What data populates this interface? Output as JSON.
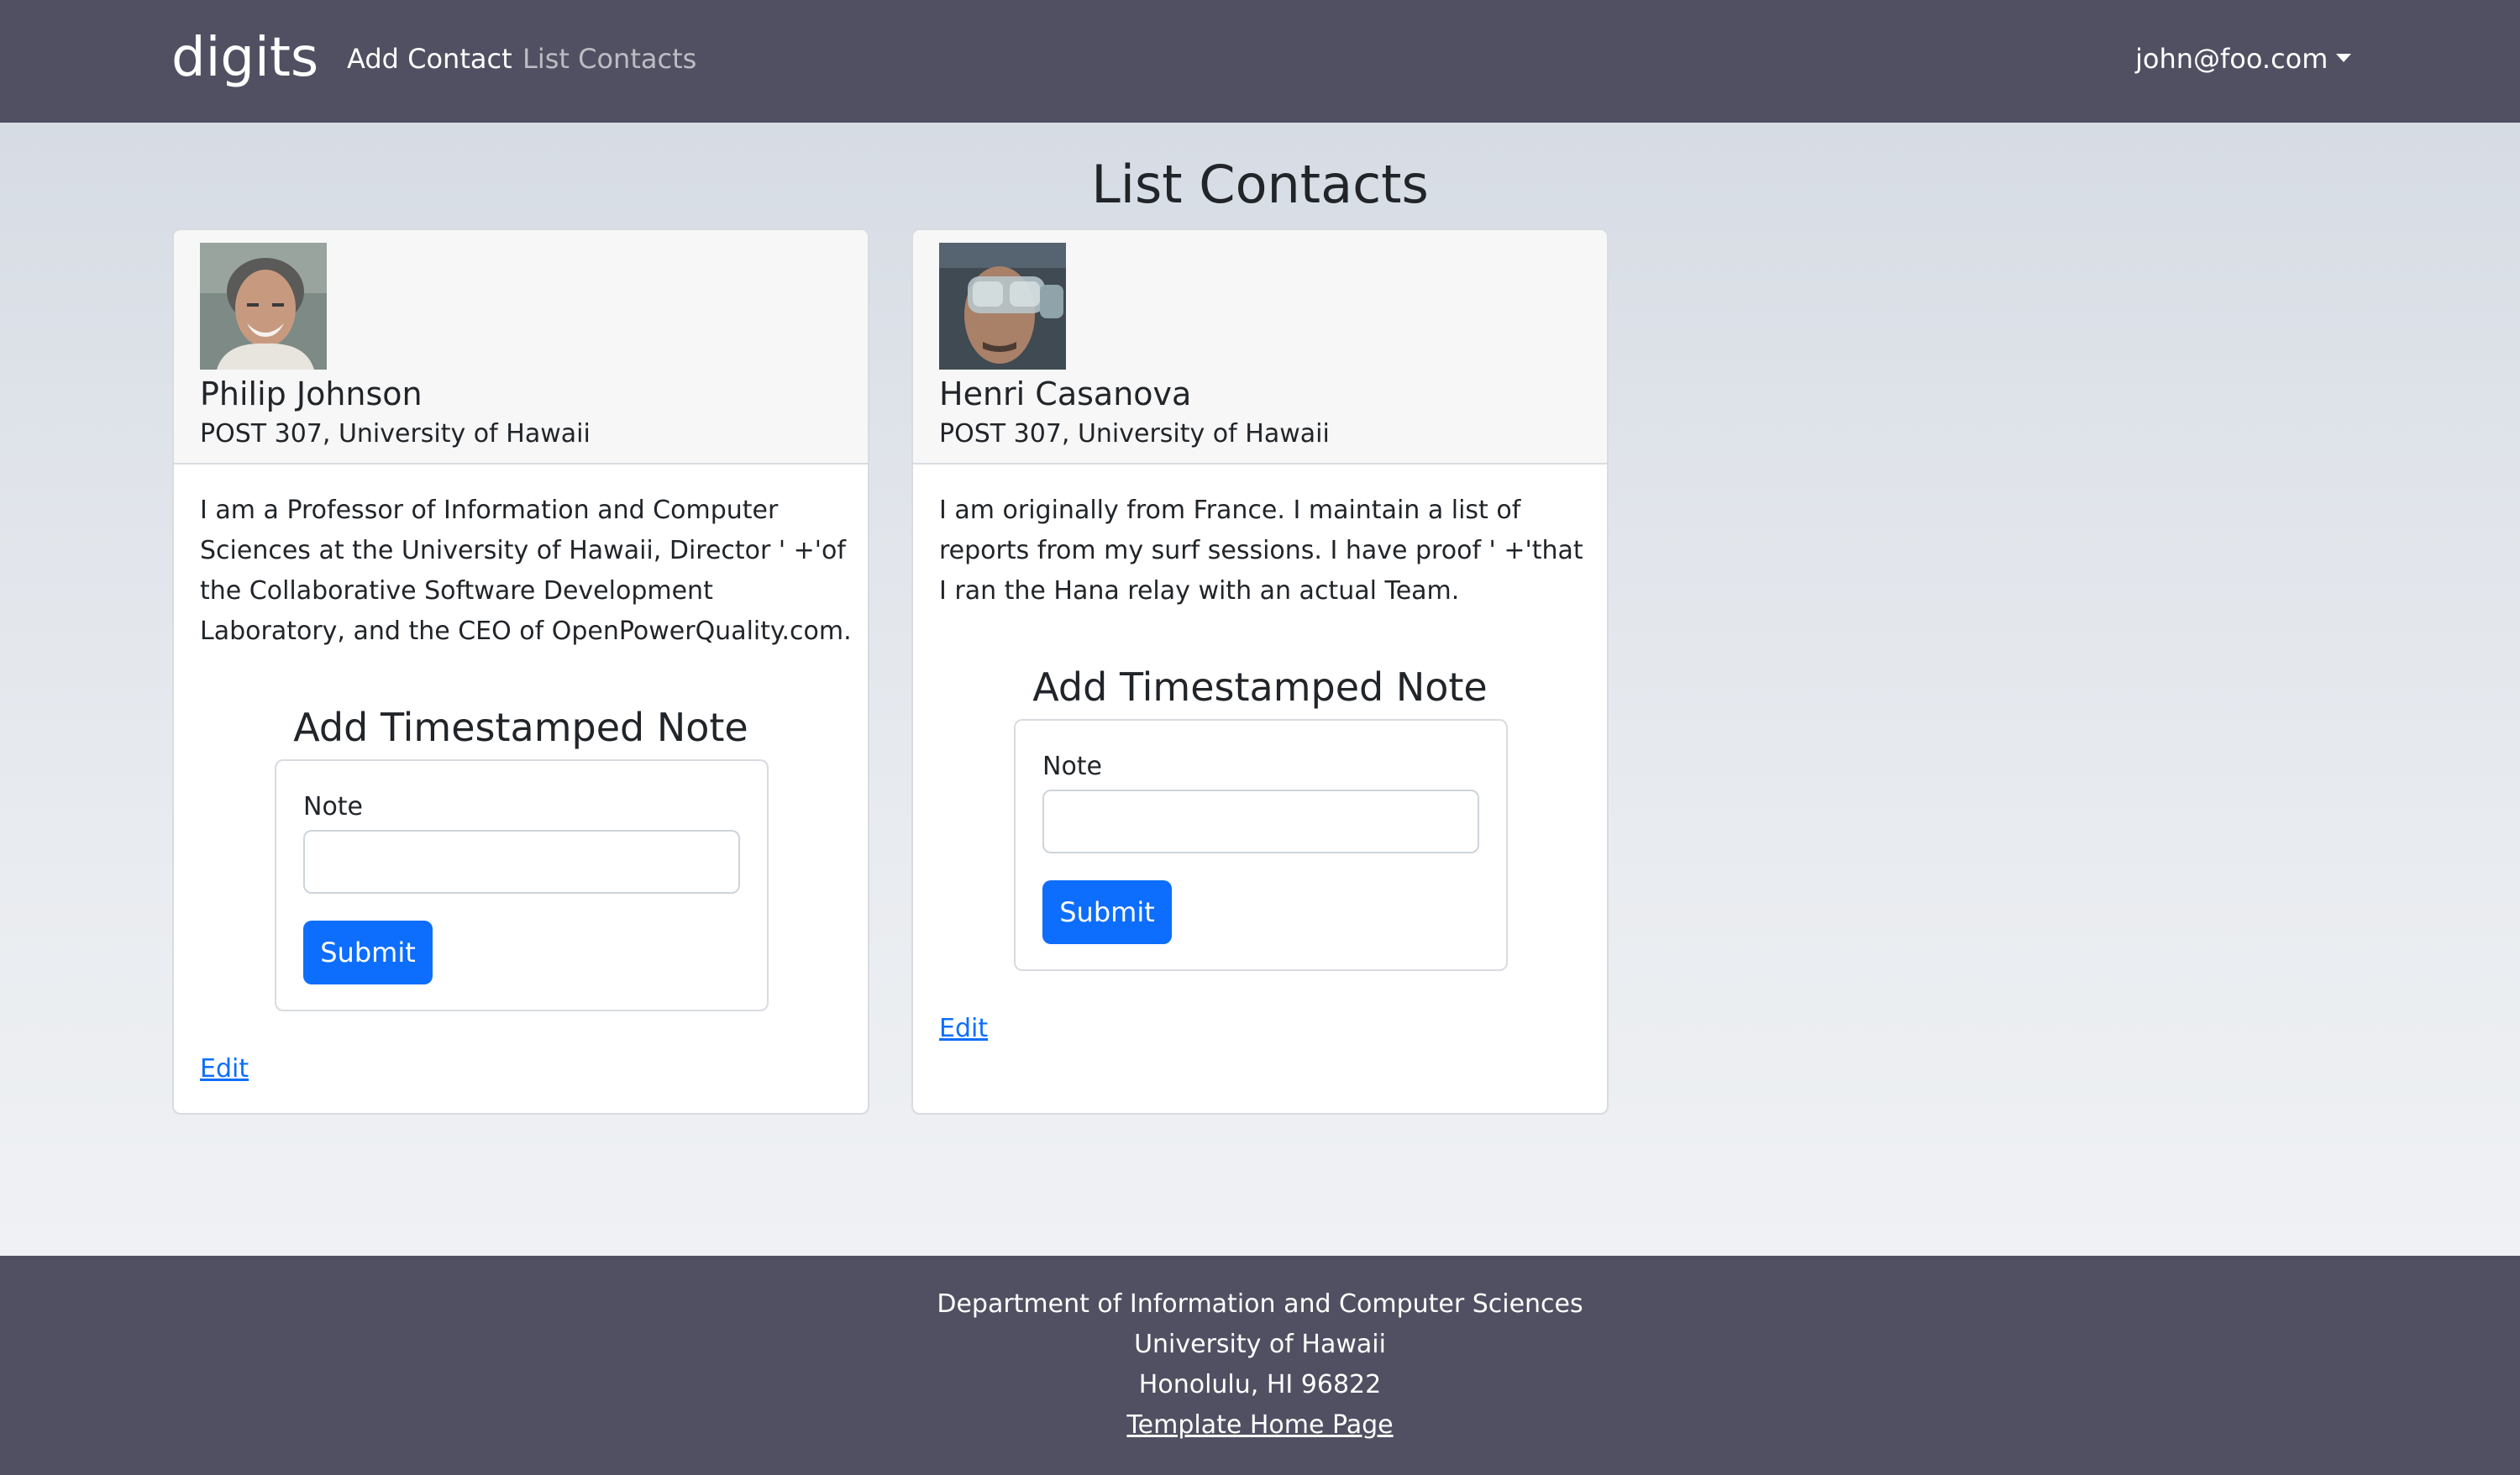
{
  "navbar": {
    "brand": "digits",
    "links": [
      {
        "label": "Add Contact"
      },
      {
        "label": "List Contacts"
      }
    ],
    "user": "john@foo.com"
  },
  "page": {
    "title": "List Contacts"
  },
  "contacts": [
    {
      "name": "Philip Johnson",
      "address": "POST 307, University of Hawaii",
      "description": "I am a Professor of Information and Computer Sciences at the University of Hawaii, Director ' +'of the Collaborative Software Development Laboratory, and the CEO of OpenPowerQuality.com.",
      "note_title": "Add Timestamped Note",
      "note_label": "Note",
      "note_value": "",
      "submit_label": "Submit",
      "edit_label": "Edit"
    },
    {
      "name": "Henri Casanova",
      "address": "POST 307, University of Hawaii",
      "description": "I am originally from France. I maintain a list of reports from my surf sessions. I have proof ' +'that I ran the Hana relay with an actual Team.",
      "note_title": "Add Timestamped Note",
      "note_label": "Note",
      "note_value": "",
      "submit_label": "Submit",
      "edit_label": "Edit"
    }
  ],
  "footer": {
    "line1": "Department of Information and Computer Sciences",
    "line2": "University of Hawaii",
    "line3": "Honolulu, HI 96822",
    "link": "Template Home Page"
  },
  "colors": {
    "navbar": "#505062",
    "primary": "#0d6efd",
    "footer": "#505062"
  }
}
